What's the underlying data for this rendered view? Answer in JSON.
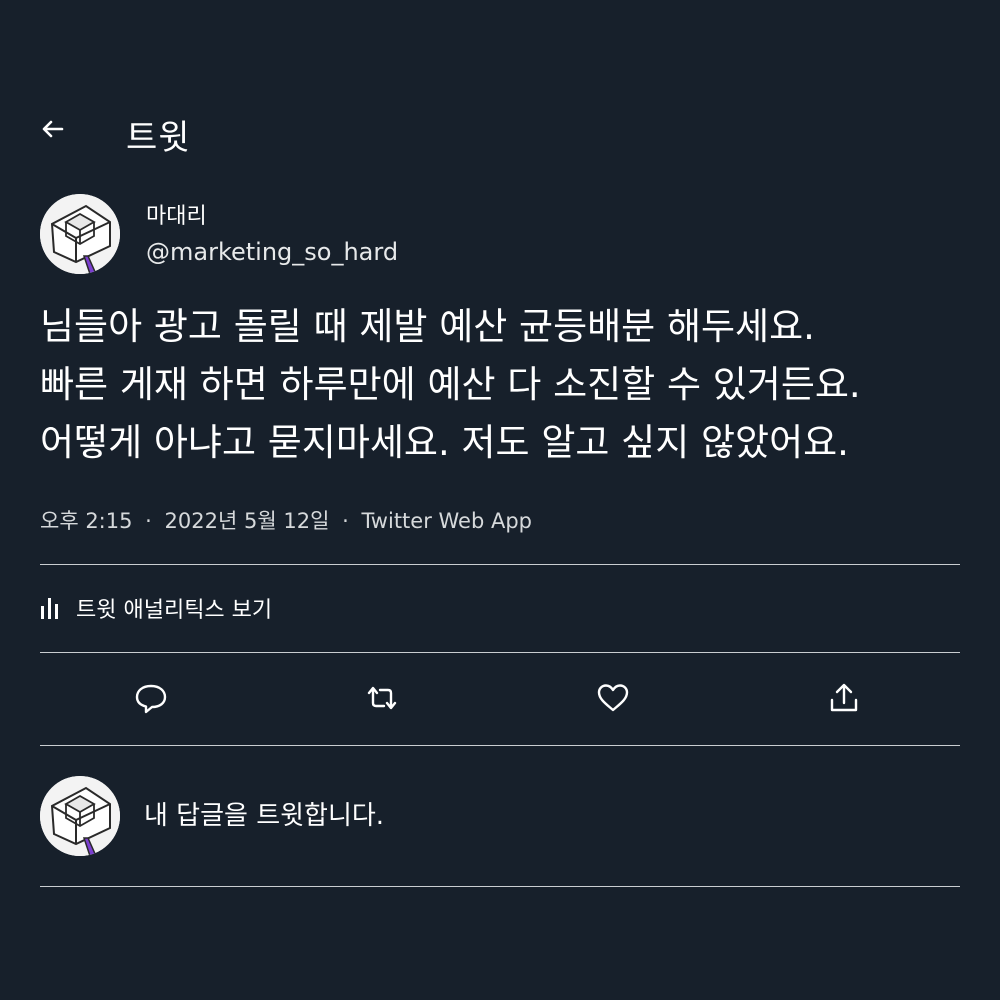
{
  "header": {
    "back_icon": "arrow-left-icon",
    "title": "트윗"
  },
  "tweet": {
    "author": {
      "display_name": "마대리",
      "handle": "@marketing_so_hard"
    },
    "text": "님들아 광고 돌릴 때 제발 예산 균등배분 해두세요.\n빠른 게재 하면 하루만에 예산 다 소진할 수 있거든요.\n어떻게 아냐고 묻지마세요. 저도 알고 싶지 않았어요.",
    "time": "오후 2:15",
    "date": "2022년 5월 12일",
    "separator": "·",
    "source": "Twitter Web App"
  },
  "analytics": {
    "icon": "bar-chart-icon",
    "label": "트윗 애널리틱스 보기"
  },
  "actions": [
    {
      "name": "reply",
      "icon": "comment-bubble-icon"
    },
    {
      "name": "retweet",
      "icon": "retweet-icon"
    },
    {
      "name": "like",
      "icon": "heart-icon"
    },
    {
      "name": "share",
      "icon": "share-upload-icon"
    }
  ],
  "reply_box": {
    "placeholder": "내 답글을 트윗합니다."
  },
  "colors": {
    "background": "#17202b",
    "text": "#ffffff",
    "divider": "#c9cdd1",
    "avatar_tie": "#7b3fd0"
  }
}
